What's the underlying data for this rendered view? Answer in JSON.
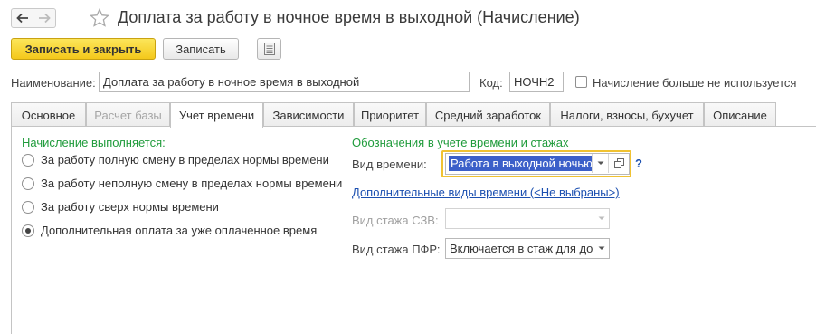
{
  "window": {
    "title": "Доплата за работу в ночное время в выходной (Начисление)"
  },
  "toolbar": {
    "save_close_label": "Записать и закрыть",
    "save_label": "Записать"
  },
  "header": {
    "name_label": "Наименование:",
    "name_value": "Доплата за работу в ночное время в выходной",
    "code_label": "Код:",
    "code_value": "НОЧН2",
    "not_used_label": "Начисление больше не используется",
    "not_used_checked": false
  },
  "tabs": [
    {
      "label": "Основное",
      "state": "normal"
    },
    {
      "label": "Расчет базы",
      "state": "disabled"
    },
    {
      "label": "Учет времени",
      "state": "active"
    },
    {
      "label": "Зависимости",
      "state": "normal"
    },
    {
      "label": "Приоритет",
      "state": "normal"
    },
    {
      "label": "Средний заработок",
      "state": "normal"
    },
    {
      "label": "Налоги, взносы, бухучет",
      "state": "normal"
    },
    {
      "label": "Описание",
      "state": "normal"
    }
  ],
  "accrual": {
    "title": "Начисление выполняется:",
    "options": [
      {
        "label": "За работу полную смену в пределах нормы времени",
        "checked": false
      },
      {
        "label": "За работу неполную смену в пределах нормы времени",
        "checked": false
      },
      {
        "label": "За работу сверх нормы времени",
        "checked": false
      },
      {
        "label": "Дополнительная оплата за уже оплаченное время",
        "checked": true
      }
    ]
  },
  "time_tracking": {
    "title": "Обозначения в учете времени и стажах",
    "time_type_label": "Вид времени:",
    "time_type_value": "Работа в выходной ночью",
    "help": "?",
    "extra_types_link": "Дополнительные виды времени (<Не выбраны>)",
    "szv_label": "Вид стажа СЗВ:",
    "szv_value": "",
    "pfr_label": "Вид стажа ПФР:",
    "pfr_value": "Включается в стаж для досрочного назначения пенсии"
  },
  "icons": {
    "back": "arrow-left-icon",
    "forward": "arrow-right-icon",
    "favorite": "star-icon",
    "list": "list-icon",
    "dropdown": "chevron-down-icon",
    "open": "open-window-icon"
  }
}
